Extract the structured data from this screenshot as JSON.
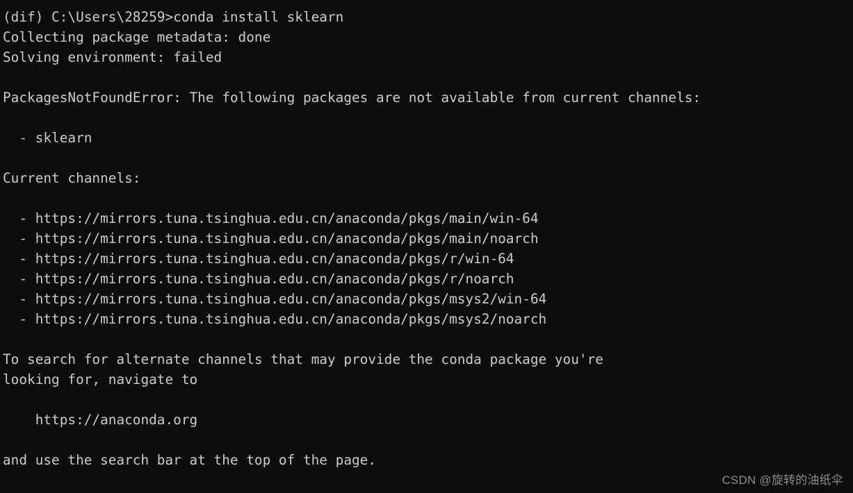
{
  "terminal": {
    "shell": "cmd",
    "background_color": "#0c0c0c",
    "foreground_color": "#cccccc",
    "prompt": {
      "env": "(dif)",
      "cwd": "C:\\Users\\28259",
      "symbol": ">",
      "command": "conda install sklearn",
      "full_line": "(dif) C:\\Users\\28259>conda install sklearn"
    },
    "lines": [
      "(dif) C:\\Users\\28259>conda install sklearn",
      "Collecting package metadata: done",
      "Solving environment: failed",
      "",
      "PackagesNotFoundError: The following packages are not available from current channels:",
      "",
      "  - sklearn",
      "",
      "Current channels:",
      "",
      "  - https://mirrors.tuna.tsinghua.edu.cn/anaconda/pkgs/main/win-64",
      "  - https://mirrors.tuna.tsinghua.edu.cn/anaconda/pkgs/main/noarch",
      "  - https://mirrors.tuna.tsinghua.edu.cn/anaconda/pkgs/r/win-64",
      "  - https://mirrors.tuna.tsinghua.edu.cn/anaconda/pkgs/r/noarch",
      "  - https://mirrors.tuna.tsinghua.edu.cn/anaconda/pkgs/msys2/win-64",
      "  - https://mirrors.tuna.tsinghua.edu.cn/anaconda/pkgs/msys2/noarch",
      "",
      "To search for alternate channels that may provide the conda package you're",
      "looking for, navigate to",
      "",
      "    https://anaconda.org",
      "",
      "and use the search bar at the top of the page."
    ],
    "status_messages": [
      "Collecting package metadata: done",
      "Solving environment: failed"
    ],
    "error": {
      "name": "PackagesNotFoundError",
      "message": "The following packages are not available from current channels:",
      "missing_packages": [
        "sklearn"
      ]
    },
    "channels": {
      "heading": "Current channels:",
      "items": [
        "https://mirrors.tuna.tsinghua.edu.cn/anaconda/pkgs/main/win-64",
        "https://mirrors.tuna.tsinghua.edu.cn/anaconda/pkgs/main/noarch",
        "https://mirrors.tuna.tsinghua.edu.cn/anaconda/pkgs/r/win-64",
        "https://mirrors.tuna.tsinghua.edu.cn/anaconda/pkgs/r/noarch",
        "https://mirrors.tuna.tsinghua.edu.cn/anaconda/pkgs/msys2/win-64",
        "https://mirrors.tuna.tsinghua.edu.cn/anaconda/pkgs/msys2/noarch"
      ]
    },
    "hint": {
      "line1": "To search for alternate channels that may provide the conda package you're",
      "line2": "looking for, navigate to",
      "url": "https://anaconda.org",
      "line3": "and use the search bar at the top of the page."
    }
  },
  "watermark": {
    "text": "CSDN @旋转的油纸伞",
    "color": "#8d8d8d"
  }
}
